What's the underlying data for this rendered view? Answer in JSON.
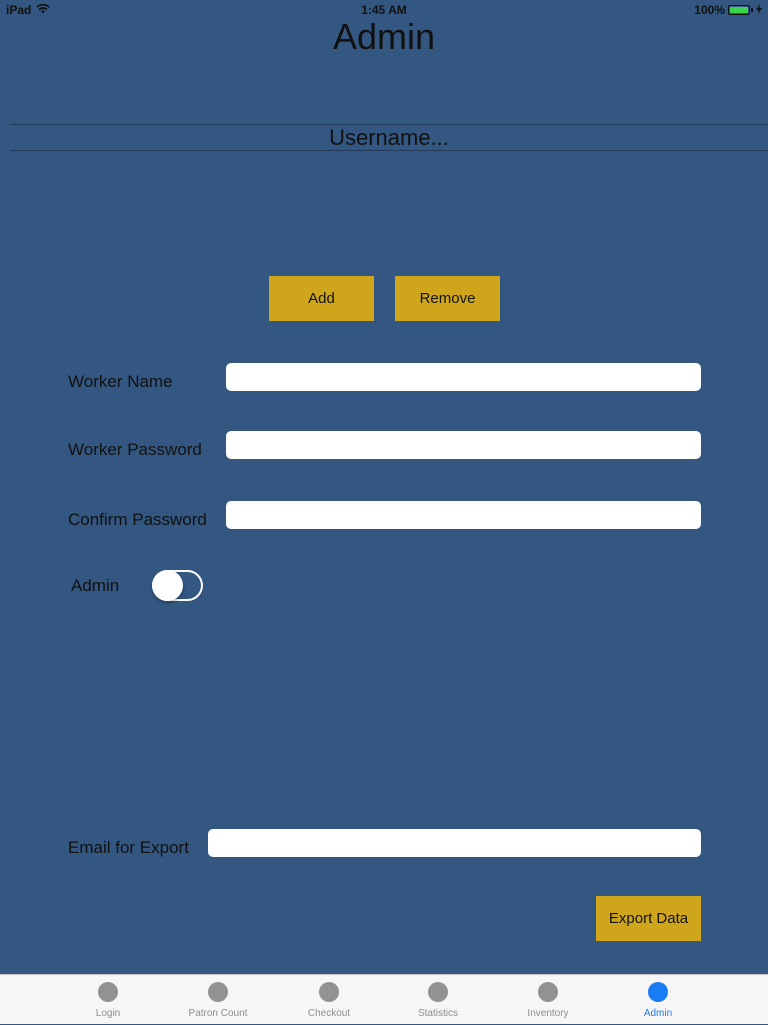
{
  "status_bar": {
    "device": "iPad",
    "time": "1:45 AM",
    "battery": "100%",
    "icons": [
      "wifi-icon",
      "battery-icon",
      "charging-bolt-icon"
    ]
  },
  "title": "Admin",
  "username": {
    "placeholder": "Username..."
  },
  "buttons": {
    "add": "Add",
    "remove": "Remove",
    "export": "Export Data"
  },
  "form": {
    "worker_name_label": "Worker Name",
    "worker_name_value": "",
    "worker_password_label": "Worker Password",
    "worker_password_value": "",
    "confirm_password_label": "Confirm Password",
    "confirm_password_value": "",
    "admin_label": "Admin",
    "admin_enabled": false,
    "email_label": "Email for Export",
    "email_value": ""
  },
  "tabs": [
    {
      "label": "Login",
      "active": false
    },
    {
      "label": "Patron Count",
      "active": false
    },
    {
      "label": "Checkout",
      "active": false
    },
    {
      "label": "Statistics",
      "active": false
    },
    {
      "label": "Inventory",
      "active": false
    },
    {
      "label": "Admin",
      "active": true
    }
  ],
  "colors": {
    "background": "#335781",
    "button": "#cfa61b",
    "tab_active": "#1a7cf5",
    "tab_inactive": "#929292"
  }
}
